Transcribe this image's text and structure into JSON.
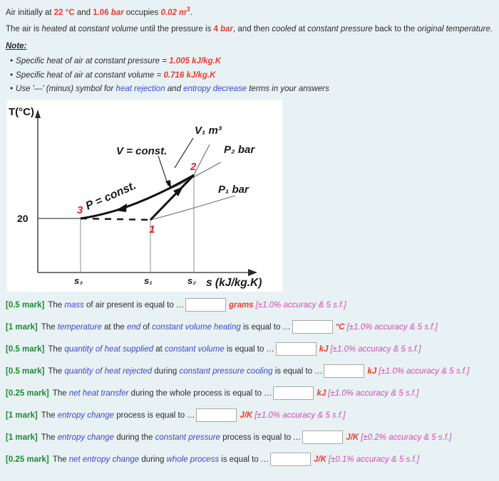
{
  "statement": {
    "line1": {
      "p1": "Air initially at ",
      "v1": "22 °C",
      "p2": " and ",
      "v2": "1.06 ",
      "v2i": "bar",
      "p3": " occupies ",
      "v3": "0.02 m",
      "v3sup": "3",
      "p4": "."
    },
    "line2": {
      "p1": "The air is ",
      "i1": "heated",
      "p2": " at ",
      "i2": "constant volume",
      "p3": " until the pressure is ",
      "v1": "4 ",
      "v1i": "bar",
      "p4": ", and then ",
      "i3": "cooled",
      "p5": " at ",
      "i4": "constant pressure",
      "p6": " back to the ",
      "i5": "original temperature",
      "p7": "."
    },
    "note_heading": "Note:",
    "notes": [
      {
        "bullet": "•",
        "i1": "Specific heat",
        "t1": " of air at ",
        "i2": "constant pressure",
        "t2": " = ",
        "val": "1.005 kJ/kg.K"
      },
      {
        "bullet": "•",
        "i1": "Specific heat",
        "t1": " of air at ",
        "i2": "constant volume",
        "t2": " = ",
        "val": "0.716 kJ/kg.K"
      },
      {
        "bullet": "•",
        "i1": "Use",
        "t1": " '—' (minus) symbol for ",
        "i2": "heat rejection",
        "t2": " and ",
        "i3": "entropy decrease",
        "t3": " terms in your answers"
      }
    ]
  },
  "diagram": {
    "y_axis_label": "T(°C)",
    "x_axis_label": "s (kJ/kg.K)",
    "y_tick_label": "20",
    "x_tick_labels": [
      "s₃",
      "s₁",
      "s₂"
    ],
    "point_labels": [
      "1",
      "2",
      "3"
    ],
    "curve_label_p_const": "P = const.",
    "curve_label_v_const": "V = const.",
    "label_v1": "V₁ m³",
    "label_p2": "P₂ bar",
    "label_p1": "P₁ bar",
    "point_color": "#ee1c25",
    "axis_color": "#4d4d4d",
    "panel_bg": "#ffffff"
  },
  "questions": [
    {
      "mark": "[0.5 mark]",
      "pre": " The ",
      "em1": "mass",
      "mid1": " of air present is equal to ",
      "dots": "...",
      "unit": "grams",
      "tol": "[±1.0% accuracy & 5 s.f.]",
      "value": "",
      "placeholder": ""
    },
    {
      "mark": "[1 mark]",
      "pre": " The ",
      "em1": "temperature",
      "mid1": " at the ",
      "em2": "end",
      "mid2": " of ",
      "em3": "constant volume heating",
      "mid3": " is equal to ",
      "dots": "...",
      "unit": "°C",
      "tol": "[±1.0% accuracy & 5 s.f.]",
      "value": "",
      "placeholder": ""
    },
    {
      "mark": "[0.5 mark]",
      "pre": " The ",
      "em1": "quantity of heat supplied",
      "mid1": " at ",
      "em2": "constant volume",
      "mid2": " is equal to ",
      "dots": "...",
      "unit": "kJ",
      "tol": "[±1.0% accuracy & 5 s.f.]",
      "value": "",
      "placeholder": ""
    },
    {
      "mark": "[0.5 mark]",
      "pre": " The ",
      "em1": "quantity of heat rejected",
      "mid1": " during ",
      "em2": "constant pressure cooling",
      "mid2": " is equal to ",
      "dots": "...",
      "unit": "kJ",
      "tol": "[±1.0% accuracy & 5 s.f.]",
      "value": "",
      "placeholder": ""
    },
    {
      "mark": "[0.25 mark]",
      "pre": " The ",
      "em1": "net heat transfer",
      "mid1": " during the whole process is equal to ",
      "dots": "...",
      "unit": "kJ",
      "tol": "[±1.0% accuracy & 5 s.f.]",
      "value": "",
      "placeholder": ""
    },
    {
      "mark": "[1 mark]",
      "pre": " The ",
      "em1": "entropy change",
      "mid1": " process is equal to ",
      "dots": "...",
      "unit": "J/K",
      "tol": "[±1.0% accuracy & 5 s.f.]",
      "value": "",
      "placeholder": ""
    },
    {
      "mark": "[1 mark]",
      "pre": " The ",
      "em1": "entropy change",
      "mid1": " during the ",
      "em2": "constant pressure",
      "mid2": " process is equal to ",
      "dots": "...",
      "unit": "J/K",
      "tol": "[±0.2% accuracy & 5 s.f.]",
      "value": "",
      "placeholder": ""
    },
    {
      "mark": "[0.25 mark]",
      "pre": " The ",
      "em1": "net entropy change",
      "mid1": " during ",
      "em2": "whole process",
      "mid2": " is equal to ",
      "dots": "...",
      "unit": "J/K",
      "tol": "[±0.1% accuracy & 5 s.f.]",
      "value": "",
      "placeholder": ""
    }
  ]
}
